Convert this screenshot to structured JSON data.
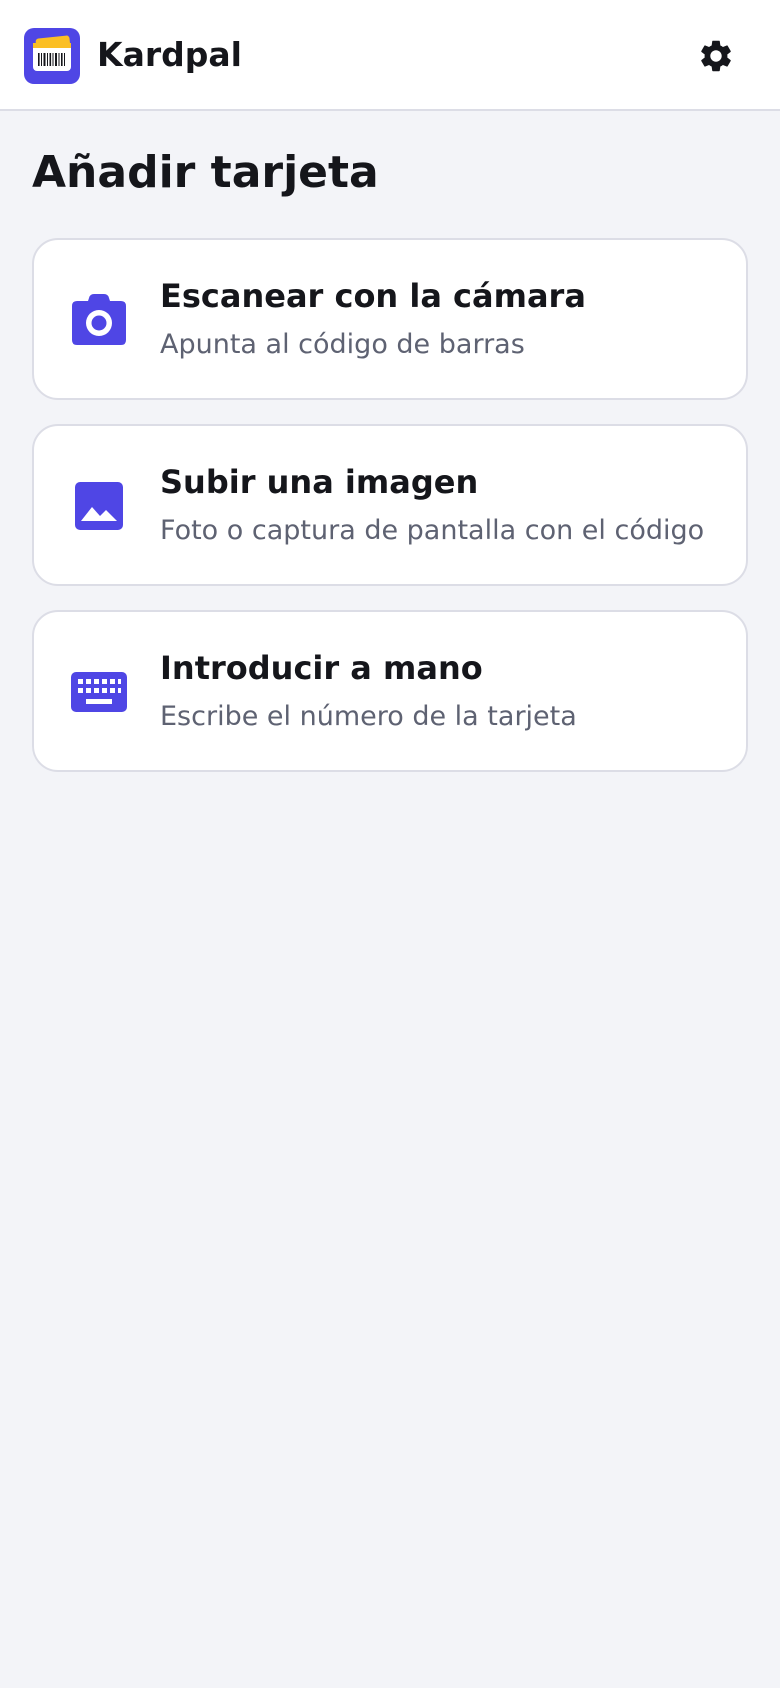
{
  "app": {
    "name": "Kardpal",
    "logo_icon": "barcode-card-logo",
    "settings_icon": "gear-icon"
  },
  "page": {
    "title": "Añadir tarjeta"
  },
  "options": [
    {
      "icon": "camera-icon",
      "title": "Escanear con la cámara",
      "subtitle": "Apunta al código de barras"
    },
    {
      "icon": "image-icon",
      "title": "Subir una imagen",
      "subtitle": "Foto o captura de pantalla con el código"
    },
    {
      "icon": "keyboard-icon",
      "title": "Introducir a mano",
      "subtitle": "Escribe el número de la tarjeta"
    }
  ],
  "colors": {
    "accent": "#4f46e5",
    "card_yellow": "#fbbf24",
    "background": "#f3f4f8",
    "surface": "#ffffff",
    "text_primary": "#15161b",
    "text_secondary": "#5e6272",
    "border": "#dcdde6"
  }
}
